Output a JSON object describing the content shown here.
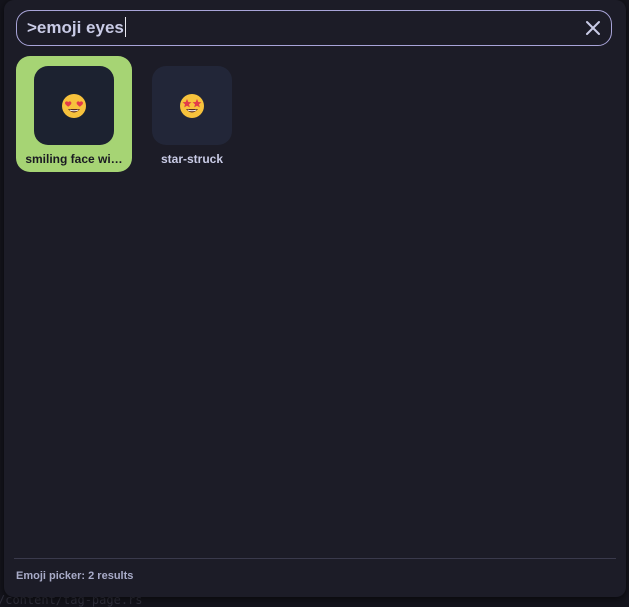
{
  "search": {
    "value": ">emoji eyes"
  },
  "results": [
    {
      "label": "smiling face wi…",
      "emoji": "smiling-face-with-heart-eyes",
      "selected": true
    },
    {
      "label": "star-struck",
      "emoji": "star-struck",
      "selected": false
    }
  ],
  "footer": {
    "status": "Emoji picker: 2 results"
  },
  "colors": {
    "panel_bg": "#1c1c27",
    "search_border": "#a8a4d8",
    "selected_tile": "#a6d474",
    "text": "#c9cbe6"
  }
}
